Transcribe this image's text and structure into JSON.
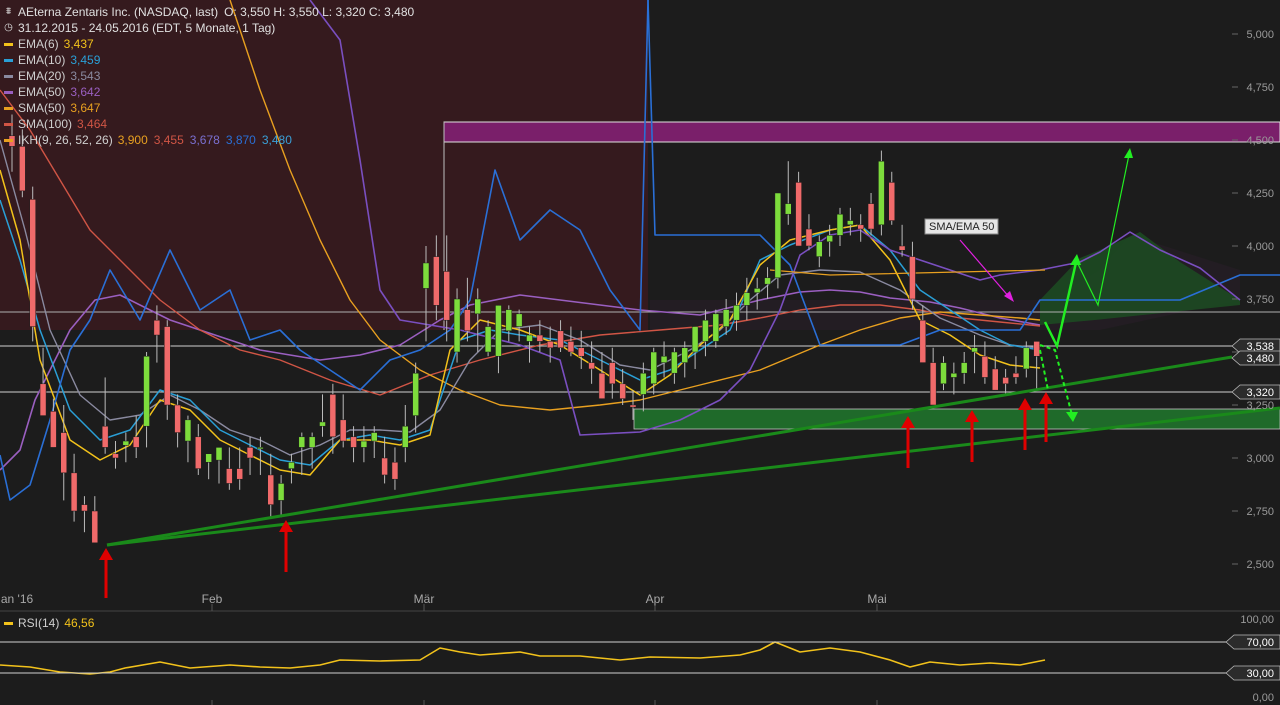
{
  "header": {
    "title": "AEterna Zentaris Inc. (NASDAQ, last)",
    "ohlc": "O: 3,550  H: 3,550  L: 3,320  C: 3,480",
    "range": "31.12.2015 - 24.05.2016 (EDT, 5 Monate, 1 Tag)"
  },
  "indicators": [
    {
      "label": "EMA(6)",
      "value": "3,437",
      "color": "#f2c21b"
    },
    {
      "label": "EMA(10)",
      "value": "3,459",
      "color": "#2a9fd6"
    },
    {
      "label": "EMA(20)",
      "value": "3,543",
      "color": "#8a8aa0"
    },
    {
      "label": "EMA(50)",
      "value": "3,642",
      "color": "#9a5fc0"
    },
    {
      "label": "SMA(50)",
      "value": "3,647",
      "color": "#e8a020"
    },
    {
      "label": "SMA(100)",
      "value": "3,464",
      "color": "#d05545"
    }
  ],
  "ikh": {
    "label": "IKH(9, 26, 52, 26)",
    "values": [
      "3,900",
      "3,455",
      "3,678",
      "3,870",
      "3,480"
    ],
    "colors": [
      "#e8a020",
      "#d05545",
      "#7a6fd0",
      "#2a6fd6",
      "#3a9fd6"
    ]
  },
  "rsi": {
    "label": "RSI(14)",
    "value": "46,56",
    "color": "#f2c21b"
  },
  "annotation": {
    "label": "SMA/EMA 50"
  },
  "colors": {
    "up": "#7ddc3c",
    "down": "#f06a6a",
    "accent_arrow": "#e00000",
    "trend": "#1a8a1a"
  },
  "chart_data": {
    "type": "candlestick",
    "y_axis": {
      "ticks": [
        "5,000",
        "4,750",
        "4,500",
        "4,250",
        "4,000",
        "3,750",
        "3,500",
        "3,250",
        "3,000",
        "2,750",
        "2,500"
      ],
      "tick_values": [
        5.0,
        4.75,
        4.5,
        4.25,
        4.0,
        3.75,
        3.5,
        3.25,
        3.0,
        2.75,
        2.5
      ]
    },
    "x_axis": {
      "labels": [
        "Jan '16",
        "Feb",
        "Mär",
        "Apr",
        "Mai"
      ]
    },
    "price_tags": [
      "3,538",
      "3,480",
      "3,320"
    ],
    "rsi_axis": {
      "ticks": [
        "100,00",
        "70,00",
        "30,00",
        "0,00"
      ]
    },
    "candles": [
      [
        4.52,
        4.62,
        4.35,
        4.47
      ],
      [
        4.47,
        4.55,
        4.23,
        4.26
      ],
      [
        4.22,
        4.28,
        3.55,
        3.62
      ],
      [
        3.35,
        3.52,
        3.22,
        3.2
      ],
      [
        3.22,
        3.28,
        3.05,
        3.05
      ],
      [
        3.12,
        3.25,
        2.8,
        2.93
      ],
      [
        2.93,
        3.02,
        2.7,
        2.75
      ],
      [
        2.78,
        2.82,
        2.65,
        2.75
      ],
      [
        2.75,
        2.82,
        2.6,
        2.6
      ],
      [
        3.15,
        3.38,
        3.02,
        3.05
      ],
      [
        3.02,
        3.08,
        2.95,
        3.0
      ],
      [
        3.06,
        3.12,
        2.98,
        3.08
      ],
      [
        3.1,
        3.2,
        3.0,
        3.05
      ],
      [
        3.15,
        3.5,
        3.05,
        3.48
      ],
      [
        3.65,
        3.72,
        3.45,
        3.58
      ],
      [
        3.62,
        3.65,
        3.18,
        3.25
      ],
      [
        3.25,
        3.3,
        3.05,
        3.12
      ],
      [
        3.08,
        3.2,
        2.98,
        3.18
      ],
      [
        3.1,
        3.16,
        2.92,
        2.95
      ],
      [
        2.98,
        3.02,
        2.9,
        3.02
      ],
      [
        2.99,
        3.02,
        2.88,
        3.05
      ],
      [
        2.95,
        3.05,
        2.85,
        2.88
      ],
      [
        2.95,
        3.05,
        2.85,
        2.9
      ],
      [
        3.05,
        3.1,
        2.92,
        3.0
      ],
      [
        3.05,
        3.1,
        2.92,
        3.05
      ],
      [
        2.92,
        3.02,
        2.72,
        2.78
      ],
      [
        2.8,
        2.92,
        2.72,
        2.88
      ],
      [
        2.95,
        3.02,
        2.88,
        2.98
      ],
      [
        3.05,
        3.12,
        2.92,
        3.1
      ],
      [
        3.05,
        3.12,
        2.95,
        3.1
      ],
      [
        3.15,
        3.3,
        3.1,
        3.17
      ],
      [
        3.3,
        3.35,
        3.02,
        3.1
      ],
      [
        3.18,
        3.3,
        3.05,
        3.08
      ],
      [
        3.1,
        3.15,
        2.98,
        3.05
      ],
      [
        3.05,
        3.15,
        2.98,
        3.08
      ],
      [
        3.08,
        3.15,
        3.0,
        3.12
      ],
      [
        3.0,
        3.1,
        2.88,
        2.92
      ],
      [
        2.98,
        3.05,
        2.85,
        2.9
      ],
      [
        3.05,
        3.25,
        2.98,
        3.15
      ],
      [
        3.2,
        3.45,
        3.12,
        3.4
      ],
      [
        3.8,
        4.0,
        3.55,
        3.92
      ],
      [
        3.95,
        4.05,
        3.65,
        3.72
      ],
      [
        3.88,
        4.05,
        3.55,
        3.65
      ],
      [
        3.5,
        3.8,
        3.45,
        3.75
      ],
      [
        3.7,
        3.85,
        3.55,
        3.6
      ],
      [
        3.68,
        3.8,
        3.5,
        3.75
      ],
      [
        3.5,
        3.65,
        3.48,
        3.62
      ],
      [
        3.48,
        3.72,
        3.4,
        3.72
      ],
      [
        3.6,
        3.72,
        3.55,
        3.7
      ],
      [
        3.62,
        3.7,
        3.55,
        3.68
      ],
      [
        3.55,
        3.62,
        3.45,
        3.58
      ],
      [
        3.58,
        3.65,
        3.5,
        3.55
      ],
      [
        3.55,
        3.62,
        3.45,
        3.52
      ],
      [
        3.6,
        3.65,
        3.5,
        3.52
      ],
      [
        3.55,
        3.62,
        3.48,
        3.5
      ],
      [
        3.52,
        3.6,
        3.42,
        3.48
      ],
      [
        3.45,
        3.55,
        3.35,
        3.42
      ],
      [
        3.4,
        3.5,
        3.28,
        3.28
      ],
      [
        3.45,
        3.52,
        3.28,
        3.35
      ],
      [
        3.35,
        3.42,
        3.25,
        3.28
      ],
      [
        3.25,
        3.32,
        3.18,
        3.24
      ],
      [
        3.3,
        3.45,
        3.22,
        3.4
      ],
      [
        3.35,
        3.52,
        3.3,
        3.5
      ],
      [
        3.45,
        3.55,
        3.38,
        3.48
      ],
      [
        3.4,
        3.52,
        3.35,
        3.5
      ],
      [
        3.45,
        3.55,
        3.38,
        3.52
      ],
      [
        3.5,
        3.62,
        3.42,
        3.62
      ],
      [
        3.55,
        3.7,
        3.48,
        3.65
      ],
      [
        3.55,
        3.7,
        3.52,
        3.68
      ],
      [
        3.62,
        3.75,
        3.58,
        3.7
      ],
      [
        3.65,
        3.78,
        3.6,
        3.72
      ],
      [
        3.72,
        3.85,
        3.65,
        3.78
      ],
      [
        3.78,
        3.85,
        3.7,
        3.8
      ],
      [
        3.82,
        3.9,
        3.75,
        3.85
      ],
      [
        3.85,
        4.25,
        3.8,
        4.25
      ],
      [
        4.15,
        4.4,
        4.1,
        4.2
      ],
      [
        4.3,
        4.35,
        4.0,
        4.0
      ],
      [
        4.08,
        4.15,
        3.98,
        4.0
      ],
      [
        3.95,
        4.05,
        3.9,
        4.02
      ],
      [
        4.02,
        4.1,
        3.95,
        4.05
      ],
      [
        4.05,
        4.18,
        4.0,
        4.15
      ],
      [
        4.1,
        4.18,
        4.05,
        4.12
      ],
      [
        4.1,
        4.15,
        4.02,
        4.08
      ],
      [
        4.2,
        4.25,
        4.05,
        4.08
      ],
      [
        4.1,
        4.45,
        4.05,
        4.4
      ],
      [
        4.3,
        4.35,
        4.1,
        4.12
      ],
      [
        4.0,
        4.1,
        3.95,
        3.98
      ],
      [
        3.95,
        4.02,
        3.7,
        3.75
      ],
      [
        3.65,
        3.72,
        3.45,
        3.45
      ],
      [
        3.45,
        3.52,
        3.25,
        3.25
      ],
      [
        3.35,
        3.48,
        3.32,
        3.45
      ],
      [
        3.38,
        3.45,
        3.3,
        3.4
      ],
      [
        3.4,
        3.5,
        3.35,
        3.45
      ],
      [
        3.5,
        3.58,
        3.4,
        3.52
      ],
      [
        3.48,
        3.55,
        3.35,
        3.38
      ],
      [
        3.42,
        3.48,
        3.32,
        3.32
      ],
      [
        3.38,
        3.42,
        3.3,
        3.35
      ],
      [
        3.4,
        3.48,
        3.35,
        3.38
      ],
      [
        3.42,
        3.55,
        3.38,
        3.52
      ],
      [
        3.55,
        3.55,
        3.32,
        3.48
      ]
    ]
  }
}
